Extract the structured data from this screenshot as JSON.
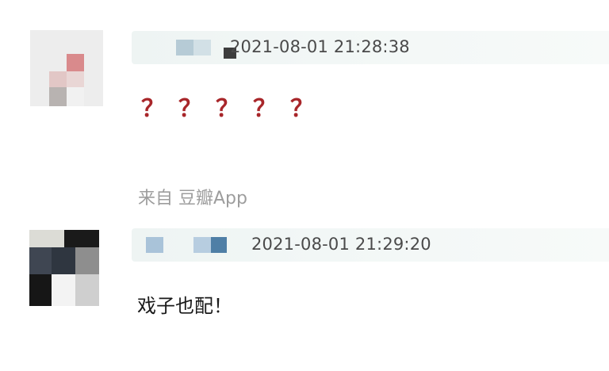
{
  "comments": [
    {
      "username": "",
      "timestamp": "2021-08-01 21:28:38",
      "content": "？？？？？",
      "source": "来自 豆瓣App"
    },
    {
      "username": "",
      "timestamp": "2021-08-01 21:29:20",
      "content": "戏子也配！"
    }
  ],
  "colors": {
    "question_marks": "#a8262a",
    "timestamp": "#4a4a4a",
    "source": "#9d9d9d",
    "meta_bar": "#eef4f3"
  }
}
